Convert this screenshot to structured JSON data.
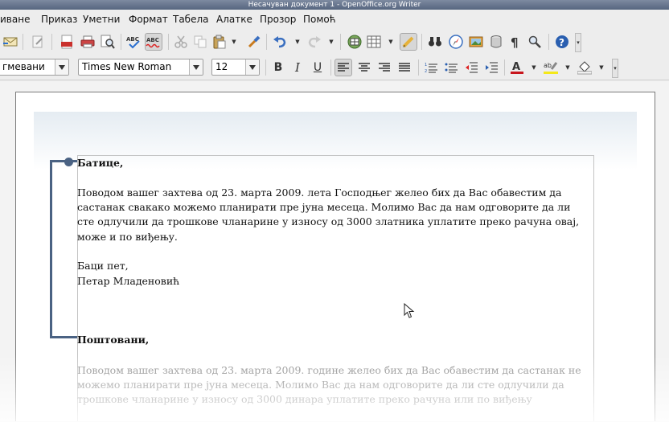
{
  "window": {
    "title": "Несачуван документ 1 - OpenOffice.org Writer"
  },
  "menu": [
    "иване",
    "Приказ",
    "Уметни",
    "Формат",
    "Табела",
    "Алатке",
    "Прозор",
    "Помоћ"
  ],
  "toolbar": {
    "style_value": "гмевани",
    "font_name": "Times New Roman",
    "font_size": "12",
    "bold_label": "B",
    "italic_label": "I",
    "underline_label": "U",
    "pdf_label": "PDF",
    "spell_label": "ABC",
    "autospell_label": "ABC",
    "accent": "#2a5fb0"
  },
  "document": {
    "greeting1": "Батице,",
    "para1": [
      "Поводом вашег захтева од 23. марта 2009. лета Господњег желео бих да Вас обавестим да",
      "састанак свакако можемо планирати пре јуна месеца. Молимо Вас да нам одговорите да ли",
      "сте одлучили да трошкове чланарине у износу од 3000 златника уплатите преко рачуна овај,",
      "може и по виђењу."
    ],
    "closing1": "Баци пет,",
    "signature1": "Петар Младеновић",
    "greeting2": "Поштовани,",
    "para2": [
      "Поводом вашег захтева од 23. марта 2009. године желео бих да Вас обавестим да састанак не",
      "можемо планирати пре јуна месеца. Молимо Вас да нам одговорите да ли сте одлучили да",
      "трошкове чланарине у износу од 3000 динара уплатите преко рачуна или по виђењу"
    ]
  }
}
